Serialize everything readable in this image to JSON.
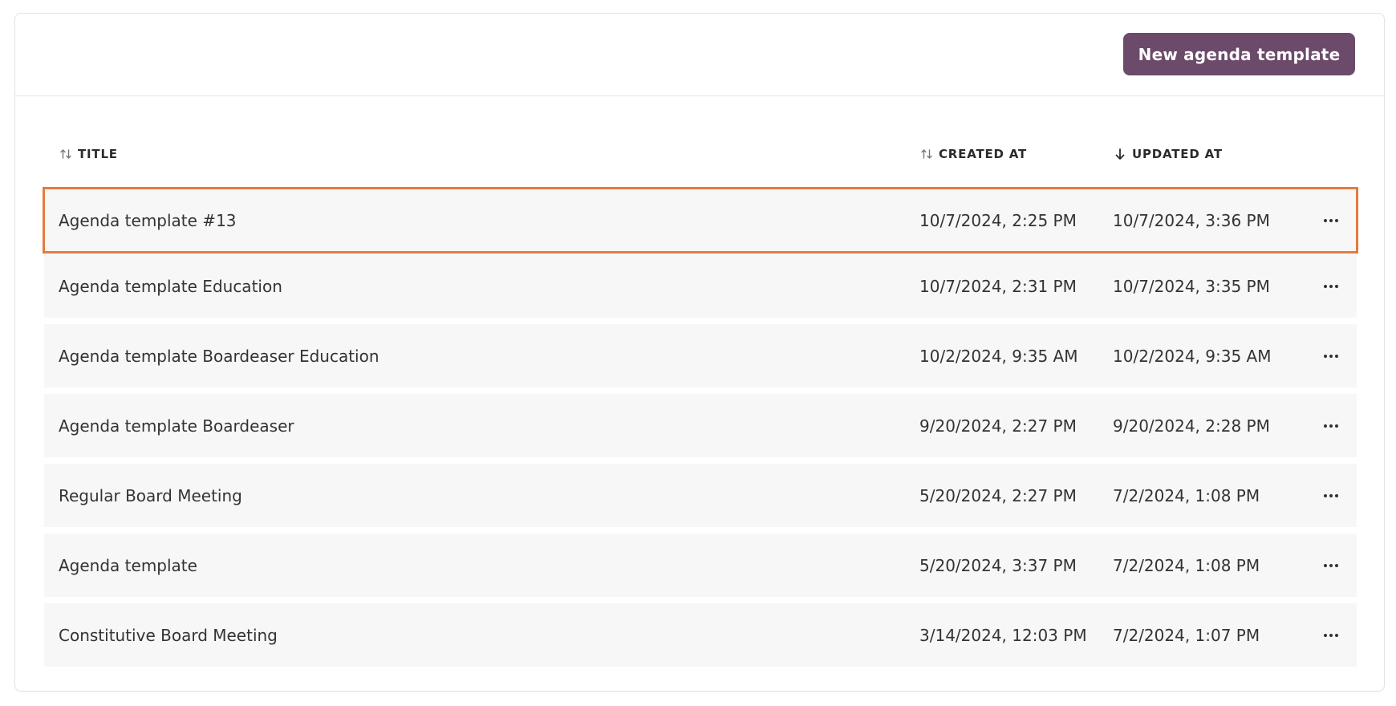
{
  "toolbar": {
    "new_button_label": "New agenda template"
  },
  "table": {
    "columns": [
      {
        "label": "TITLE",
        "sort": "unsorted"
      },
      {
        "label": "CREATED AT",
        "sort": "unsorted"
      },
      {
        "label": "UPDATED AT",
        "sort": "descending"
      }
    ],
    "rows": [
      {
        "title": "Agenda template #13",
        "created_at": "10/7/2024, 2:25 PM",
        "updated_at": "10/7/2024, 3:36 PM",
        "highlighted": true
      },
      {
        "title": "Agenda template Education",
        "created_at": "10/7/2024, 2:31 PM",
        "updated_at": "10/7/2024, 3:35 PM"
      },
      {
        "title": "Agenda template Boardeaser Education",
        "created_at": "10/2/2024, 9:35 AM",
        "updated_at": "10/2/2024, 9:35 AM"
      },
      {
        "title": "Agenda template Boardeaser",
        "created_at": "9/20/2024, 2:27 PM",
        "updated_at": "9/20/2024, 2:28 PM"
      },
      {
        "title": "Regular Board Meeting",
        "created_at": "5/20/2024, 2:27 PM",
        "updated_at": "7/2/2024, 1:08 PM"
      },
      {
        "title": "Agenda template",
        "created_at": "5/20/2024, 3:37 PM",
        "updated_at": "7/2/2024, 1:08 PM"
      },
      {
        "title": "Constitutive Board Meeting",
        "created_at": "3/14/2024, 12:03 PM",
        "updated_at": "7/2/2024, 1:07 PM"
      }
    ]
  },
  "colors": {
    "button_bg": "#6c4a6a",
    "row_bg": "#f7f7f7",
    "highlight_border": "#e57a3c"
  },
  "icons": {
    "unsorted": "sort-arrows-icon",
    "descending": "arrow-down-icon",
    "row_menu": "more-horizontal-icon"
  }
}
